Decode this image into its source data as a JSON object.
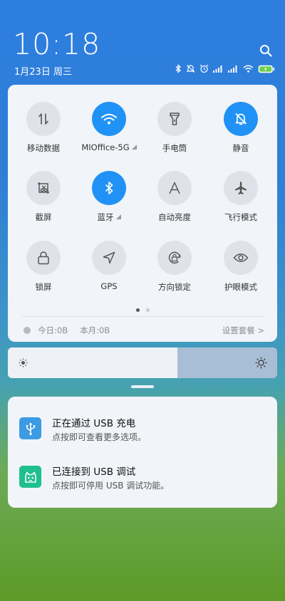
{
  "status": {
    "time": "10:18",
    "date": "1月23日 周三",
    "icons": [
      "bluetooth-icon",
      "mute-icon",
      "alarm-icon",
      "signal-icon",
      "signal-icon",
      "wifi-icon",
      "battery-charging-icon"
    ]
  },
  "quick_settings": {
    "tiles": [
      {
        "label": "移动数据",
        "icon": "mobile-data-icon",
        "active": false
      },
      {
        "label": "MIOffice-5G",
        "icon": "wifi-icon",
        "active": true,
        "expand": true
      },
      {
        "label": "手电筒",
        "icon": "flashlight-icon",
        "active": false
      },
      {
        "label": "静音",
        "icon": "mute-icon",
        "active": true
      },
      {
        "label": "截屏",
        "icon": "screenshot-icon",
        "active": false
      },
      {
        "label": "蓝牙",
        "icon": "bluetooth-icon",
        "active": true,
        "expand": true
      },
      {
        "label": "自动亮度",
        "icon": "auto-brightness-icon",
        "active": false
      },
      {
        "label": "飞行模式",
        "icon": "airplane-icon",
        "active": false
      },
      {
        "label": "锁屏",
        "icon": "lock-icon",
        "active": false
      },
      {
        "label": "GPS",
        "icon": "gps-icon",
        "active": false
      },
      {
        "label": "方向锁定",
        "icon": "rotation-lock-icon",
        "active": false
      },
      {
        "label": "护眼模式",
        "icon": "eye-icon",
        "active": false
      }
    ],
    "page_count": 2,
    "current_page": 1,
    "data_usage": {
      "today": "今日:0B",
      "month": "本月:0B",
      "settings": "设置套餐 >"
    }
  },
  "brightness": {
    "level_percent": 63
  },
  "notifications": [
    {
      "title": "正在通过 USB 充电",
      "subtitle": "点按即可查看更多选项。",
      "icon": "usb-icon",
      "color": "#3c9be3"
    },
    {
      "title": "已连接到 USB 调试",
      "subtitle": "点按即可停用 USB 调试功能。",
      "icon": "android-debug-icon",
      "color": "#1fbf8e"
    }
  ]
}
